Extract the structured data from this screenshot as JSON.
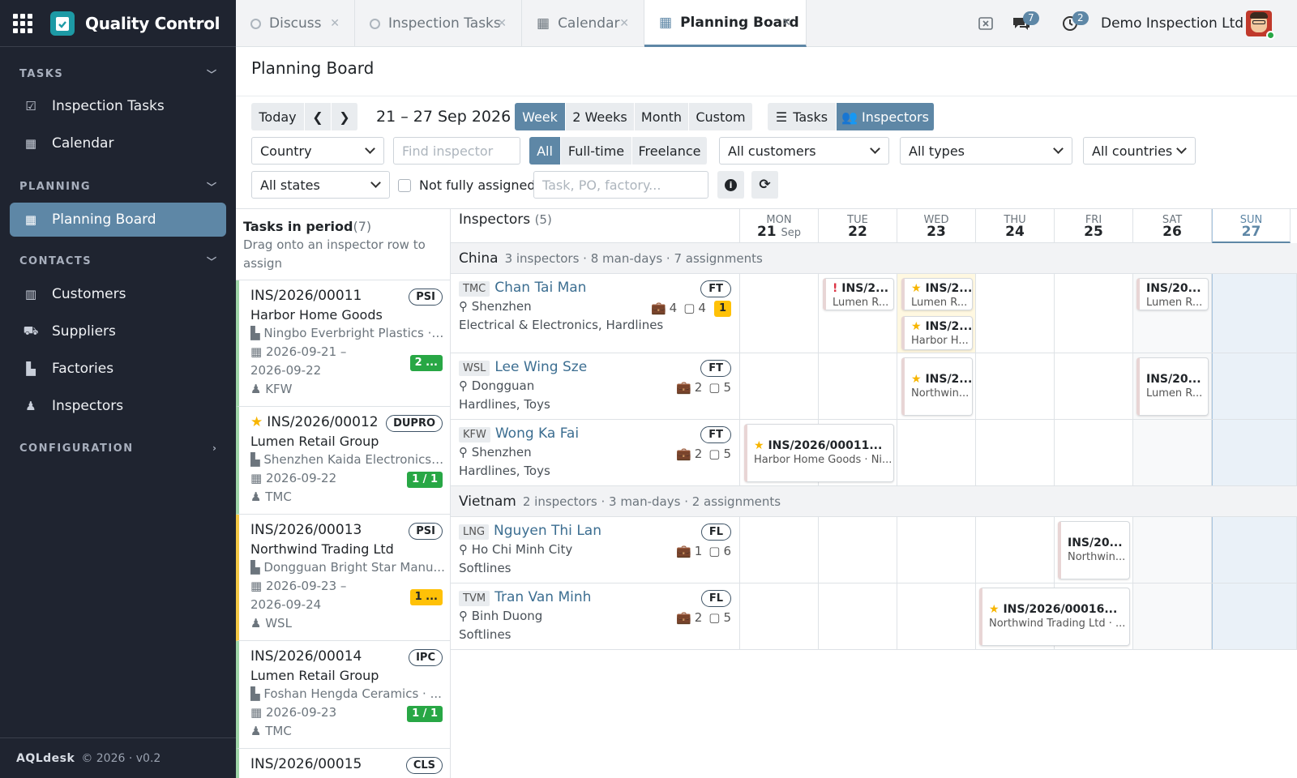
{
  "app": {
    "title": "Quality Control",
    "footer_brand": "AQLdesk",
    "footer_meta": "© 2026 · v0.2"
  },
  "sidebar": {
    "sections": [
      {
        "label": "TASKS",
        "items": [
          "Inspection Tasks",
          "Calendar"
        ]
      },
      {
        "label": "PLANNING",
        "items": [
          "Planning Board"
        ]
      },
      {
        "label": "CONTACTS",
        "items": [
          "Customers",
          "Suppliers",
          "Factories",
          "Inspectors"
        ]
      },
      {
        "label": "CONFIGURATION",
        "items": []
      }
    ]
  },
  "tabs": [
    {
      "label": "Discuss"
    },
    {
      "label": "Inspection Tasks"
    },
    {
      "label": "Calendar"
    },
    {
      "label": "Planning Board",
      "active": true
    }
  ],
  "topbar": {
    "chat_count": "7",
    "activity_count": "2",
    "company": "Demo Inspection Ltd"
  },
  "page": {
    "title": "Planning Board"
  },
  "toolbar": {
    "today": "Today",
    "range": "21 – 27 Sep 2026",
    "views": [
      "Week",
      "2 Weeks",
      "Month",
      "Custom"
    ],
    "tasks": "Tasks",
    "inspectors": "Inspectors",
    "country": "Country",
    "find_inspector": "Find inspector",
    "emp": [
      "All",
      "Full-time",
      "Freelance"
    ],
    "customers": "All customers",
    "types": "All types",
    "countries": "All countries",
    "states": "All states",
    "not_assigned": "Not fully assigned",
    "search_ph": "Task, PO, factory..."
  },
  "left": {
    "heading": "Tasks in period",
    "count": "(7)",
    "sub": "Drag onto an inspector row to assign",
    "tasks": [
      {
        "no": "INS/2026/00011",
        "type": "PSI",
        "cust": "Harbor Home Goods",
        "fac": "Ningbo Everbright Plastics · ...",
        "d1": "2026-09-21 –",
        "d2": "2026-09-22",
        "who": "KFW",
        "cnt": "2 ..."
      },
      {
        "no": "INS/2026/00012",
        "type": "DUPRO",
        "cust": "Lumen Retail Group",
        "fac": "Shenzhen Kaida Electronics ...",
        "d1": "2026-09-22",
        "who": "TMC",
        "cnt": "1 / 1"
      },
      {
        "no": "INS/2026/00013",
        "type": "PSI",
        "cust": "Northwind Trading Ltd",
        "fac": "Dongguan Bright Star Manu...",
        "d1": "2026-09-23 –",
        "d2": "2026-09-24",
        "who": "WSL",
        "cnt": "1 ..."
      },
      {
        "no": "INS/2026/00014",
        "type": "IPC",
        "cust": "Lumen Retail Group",
        "fac": "Foshan Hengda Ceramics · ...",
        "d1": "2026-09-23",
        "who": "TMC",
        "cnt": "1 / 1"
      },
      {
        "no": "INS/2026/00015",
        "type": "CLS"
      }
    ]
  },
  "grid": {
    "heading": "Inspectors",
    "count": "(5)",
    "days": [
      {
        "dow": "MON",
        "d": "21",
        "m": "Sep"
      },
      {
        "dow": "TUE",
        "d": "22"
      },
      {
        "dow": "WED",
        "d": "23"
      },
      {
        "dow": "THU",
        "d": "24"
      },
      {
        "dow": "FRI",
        "d": "25"
      },
      {
        "dow": "SAT",
        "d": "26"
      },
      {
        "dow": "SUN",
        "d": "27"
      }
    ],
    "groups": [
      {
        "name": "China",
        "meta": "3 inspectors · 8 man-days · 7 assignments"
      },
      {
        "name": "Vietnam",
        "meta": "2 inspectors · 3 man-days · 2 assignments"
      }
    ],
    "inspectors": [
      {
        "code": "TMC",
        "name": "Chan Tai Man",
        "type": "FT",
        "loc": "Shenzhen",
        "skills": "Electrical & Electronics, Hardlines",
        "a": "4",
        "b": "4",
        "c": "1"
      },
      {
        "code": "WSL",
        "name": "Lee Wing Sze",
        "type": "FT",
        "loc": "Dongguan",
        "skills": "Hardlines, Toys",
        "a": "2",
        "b": "5"
      },
      {
        "code": "KFW",
        "name": "Wong Ka Fai",
        "type": "FT",
        "loc": "Shenzhen",
        "skills": "Hardlines, Toys",
        "a": "2",
        "b": "5"
      },
      {
        "code": "LNG",
        "name": "Nguyen Thi Lan",
        "type": "FL",
        "loc": "Ho Chi Minh City",
        "skills": "Softlines",
        "a": "1",
        "b": "6"
      },
      {
        "code": "TVM",
        "name": "Tran Van Minh",
        "type": "FL",
        "loc": "Binh Duong",
        "skills": "Softlines",
        "a": "2",
        "b": "5"
      }
    ],
    "chips": [
      {
        "t": "INS/2...",
        "s": "Lumen R..."
      },
      {
        "t": "INS/2...",
        "s": "Lumen R..."
      },
      {
        "t": "INS/2...",
        "s": "Harbor H..."
      },
      {
        "t": "INS/20...",
        "s": "Lumen R..."
      },
      {
        "t": "INS/2...",
        "s": "Northwin..."
      },
      {
        "t": "INS/20...",
        "s": "Lumen R..."
      },
      {
        "t": "INS/2026/00011...",
        "s": "Harbor Home Goods · Ni..."
      },
      {
        "t": "INS/20...",
        "s": "Northwin..."
      },
      {
        "t": "INS/2026/00016...",
        "s": "Northwind Trading Ltd · ..."
      }
    ]
  }
}
